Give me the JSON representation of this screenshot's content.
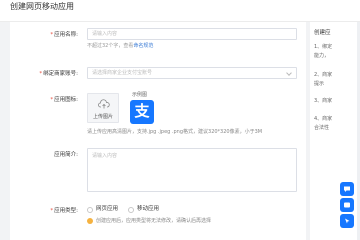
{
  "header": {
    "title": "创建网页移动应用"
  },
  "form": {
    "app_name": {
      "label": "应用名称:",
      "placeholder": "请输入内容",
      "hint_prefix": "不超过32个字，查看",
      "hint_link": "命名规范"
    },
    "merchant": {
      "label": "绑定商家账号:",
      "placeholder": "请选择商家企业支付宝账号"
    },
    "icon": {
      "label": "应用图标:",
      "upload_label": "上传图片",
      "example_label": "示例图",
      "example_glyph": "支",
      "hint": "请上传应用高清图片，支持.jpg .jpeg .png格式，建议320*320像素，小于3M"
    },
    "intro": {
      "label": "应用简介:",
      "placeholder": "请输入内容"
    },
    "type": {
      "label": "应用类型:",
      "options": [
        "网页应用",
        "移动应用"
      ],
      "warning": "创建应用后，应用类型将无法修改，请确认后再选择"
    }
  },
  "sidebar": {
    "title": "创建应",
    "lines": [
      "1、绑定",
      "能力，",
      "2、商家",
      "提示",
      "3、商家",
      "4、商家",
      "合法性"
    ]
  },
  "colors": {
    "brand": "#1677ff",
    "required": "#e74c3c",
    "warning": "#f5b240",
    "link": "#3a7bd5"
  },
  "icons": [
    "upload-cloud-icon",
    "alipay-logo",
    "chevron-down-icon",
    "chat-icon",
    "message-icon",
    "pin-icon"
  ]
}
